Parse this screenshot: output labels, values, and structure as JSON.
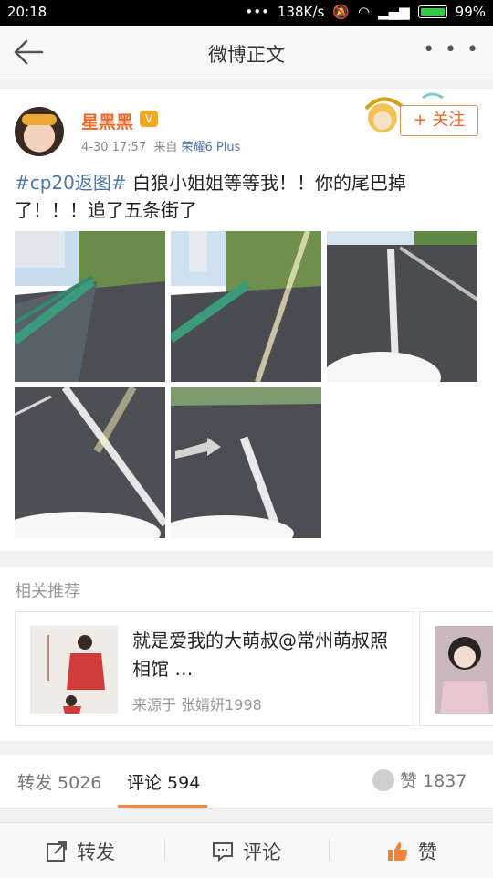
{
  "status_bar": {
    "time": "20:18",
    "network_speed": "138K/s",
    "battery": "99%"
  },
  "nav": {
    "title": "微博正文"
  },
  "post": {
    "username": "星黑黑",
    "vip_badge": "V",
    "time": "4-30 17:57",
    "source_prefix": "来自",
    "source": "荣耀6 Plus",
    "follow_label": "+ 关注",
    "topic": "#cp20返图#",
    "text": " 白狼小姐姐等等我！！你的尾巴掉了！！！追了五条街了"
  },
  "related": {
    "header": "相关推荐",
    "item_title": "就是爱我的大萌叔@常州萌叔照相馆 …",
    "item_source": "来源于 张婧妍1998"
  },
  "tabs": {
    "repost": "转发 5026",
    "comment": "评论 594",
    "like": "赞 1837"
  },
  "toolbar": {
    "repost": "转发",
    "comment": "评论",
    "like": "赞"
  },
  "colors": {
    "accent": "#ea6a2e",
    "link": "#5076a8"
  }
}
